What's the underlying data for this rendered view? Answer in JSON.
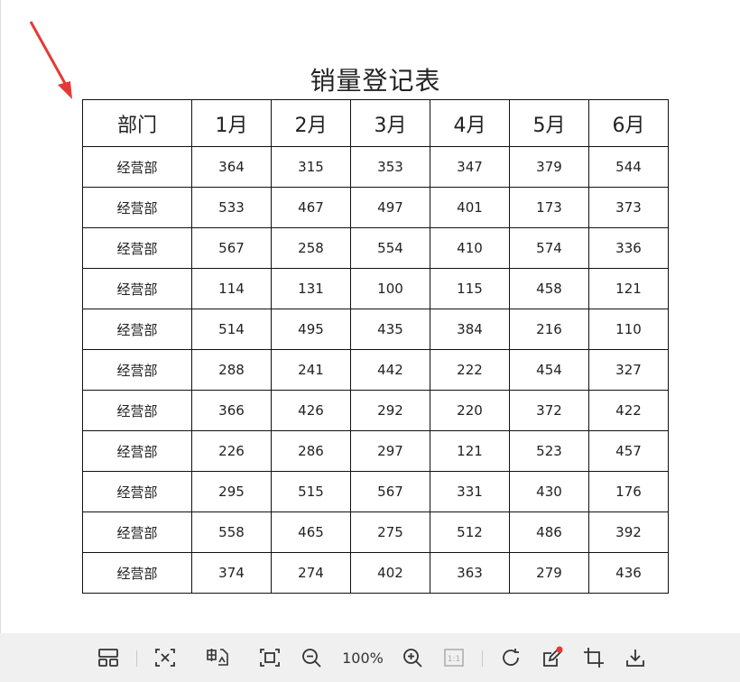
{
  "document": {
    "title": "销量登记表",
    "header": [
      "部门",
      "1月",
      "2月",
      "3月",
      "4月",
      "5月",
      "6月"
    ],
    "rows": [
      [
        "经营部",
        "364",
        "315",
        "353",
        "347",
        "379",
        "544"
      ],
      [
        "经营部",
        "533",
        "467",
        "497",
        "401",
        "173",
        "373"
      ],
      [
        "经营部",
        "567",
        "258",
        "554",
        "410",
        "574",
        "336"
      ],
      [
        "经营部",
        "114",
        "131",
        "100",
        "115",
        "458",
        "121"
      ],
      [
        "经营部",
        "514",
        "495",
        "435",
        "384",
        "216",
        "110"
      ],
      [
        "经营部",
        "288",
        "241",
        "442",
        "222",
        "454",
        "327"
      ],
      [
        "经营部",
        "366",
        "426",
        "292",
        "220",
        "372",
        "422"
      ],
      [
        "经营部",
        "226",
        "286",
        "297",
        "121",
        "523",
        "457"
      ],
      [
        "经营部",
        "295",
        "515",
        "567",
        "331",
        "430",
        "176"
      ],
      [
        "经营部",
        "558",
        "465",
        "275",
        "512",
        "486",
        "392"
      ],
      [
        "经营部",
        "374",
        "274",
        "402",
        "363",
        "279",
        "436"
      ]
    ]
  },
  "toolbar": {
    "zoom": "100%",
    "actual_size_label": "1:1",
    "icons": [
      "layout-icon",
      "fit-width-icon",
      "ocr-icon",
      "fit-screen-icon",
      "zoom-out-icon",
      "zoom-in-icon",
      "actual-size-icon",
      "rotate-icon",
      "edit-icon",
      "crop-icon",
      "download-icon"
    ]
  },
  "colors": {
    "arrow": "#e53935",
    "toolbar_bg": "#f0f0f0",
    "icon": "#333333",
    "notify_dot": "#e53935"
  }
}
